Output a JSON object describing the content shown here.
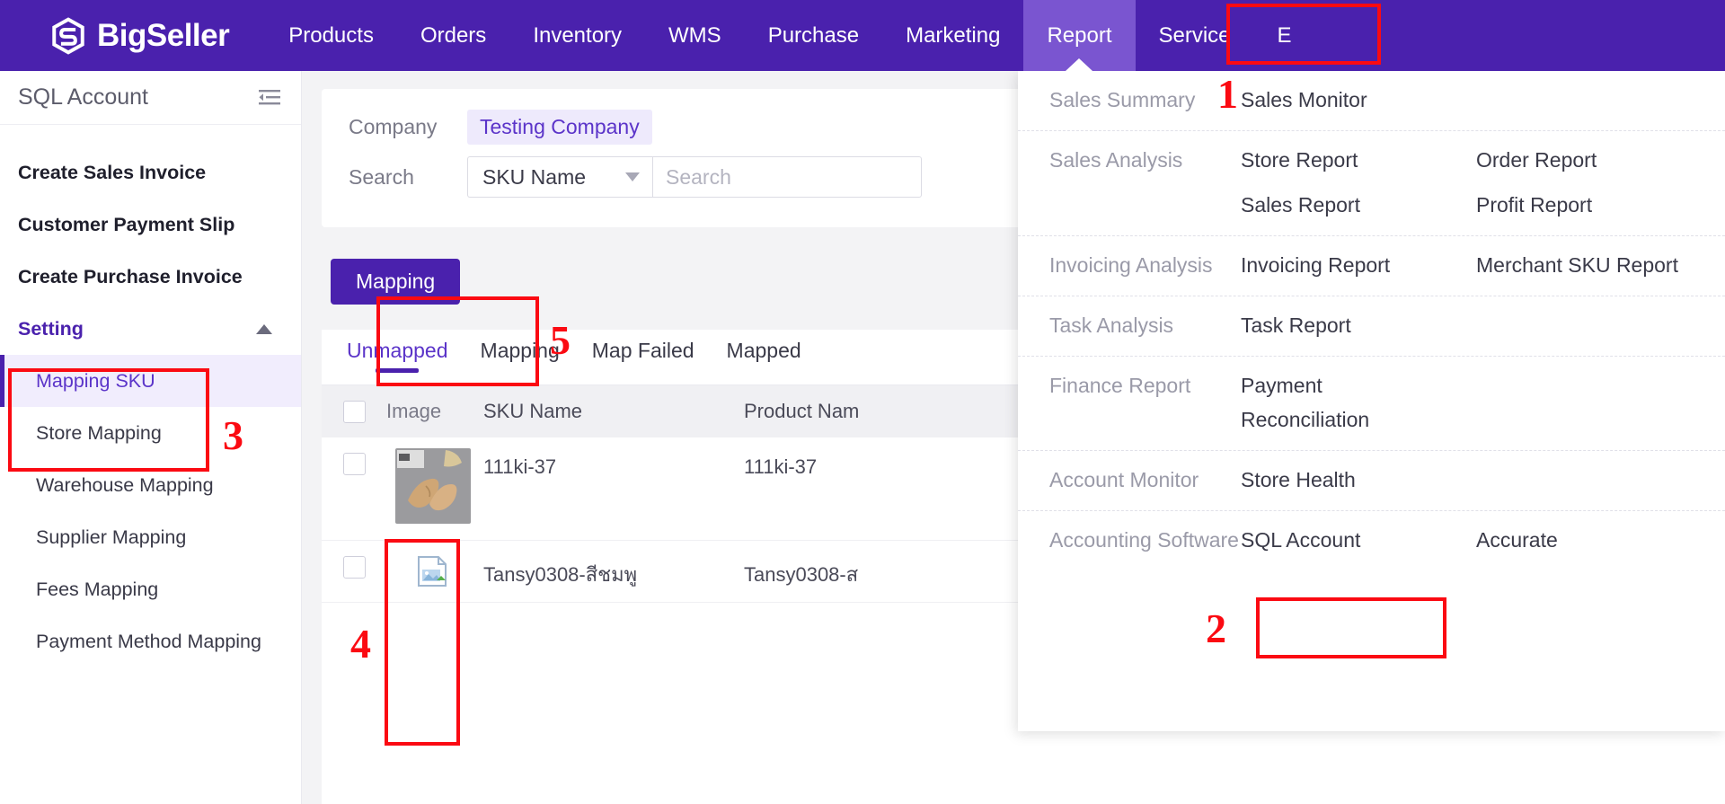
{
  "brand": {
    "name": "BigSeller",
    "logo_icon": "bigseller-logo-icon"
  },
  "topnav": {
    "items": [
      {
        "label": "Products",
        "active": false
      },
      {
        "label": "Orders",
        "active": false
      },
      {
        "label": "Inventory",
        "active": false
      },
      {
        "label": "WMS",
        "active": false
      },
      {
        "label": "Purchase",
        "active": false
      },
      {
        "label": "Marketing",
        "active": false
      },
      {
        "label": "Report",
        "active": true
      },
      {
        "label": "Service",
        "active": false
      },
      {
        "label": "E",
        "active": false
      }
    ]
  },
  "sidebar": {
    "title": "SQL Account",
    "collapse_icon": "collapse-panel-icon",
    "items": [
      {
        "label": "Create Sales Invoice",
        "type": "item"
      },
      {
        "label": "Customer Payment Slip",
        "type": "item"
      },
      {
        "label": "Create Purchase Invoice",
        "type": "item"
      },
      {
        "label": "Setting",
        "type": "group",
        "expanded": true,
        "chevron_icon": "chevron-up-icon"
      },
      {
        "label": "Mapping SKU",
        "type": "sub",
        "active": true
      },
      {
        "label": "Store Mapping",
        "type": "sub",
        "active": false
      },
      {
        "label": "Warehouse Mapping",
        "type": "sub",
        "active": false
      },
      {
        "label": "Supplier Mapping",
        "type": "sub",
        "active": false
      },
      {
        "label": "Fees Mapping",
        "type": "sub",
        "active": false
      },
      {
        "label": "Payment Method Mapping",
        "type": "sub",
        "active": false
      }
    ]
  },
  "filters": {
    "company_label": "Company",
    "company_value": "Testing Company",
    "search_label": "Search",
    "search_field_selected": "SKU Name",
    "search_placeholder": "Search",
    "dropdown_icon": "chevron-down-icon"
  },
  "toolbar": {
    "mapping_button": "Mapping"
  },
  "tabs": [
    {
      "label": "Unmapped",
      "active": true
    },
    {
      "label": "Mapping",
      "active": false
    },
    {
      "label": "Map Failed",
      "active": false
    },
    {
      "label": "Mapped",
      "active": false
    }
  ],
  "table": {
    "columns": [
      "Image",
      "SKU Name",
      "Product Nam"
    ],
    "rows": [
      {
        "sku_name": "111ki-37",
        "product_name": "111ki-37",
        "image_type": "photo"
      },
      {
        "sku_name": "Tansy0308-สีชมพู",
        "product_name": "Tansy0308-ส",
        "image_type": "broken"
      }
    ]
  },
  "mega_menu": {
    "sections": [
      {
        "category": "Sales Summary",
        "columns": [
          [
            "Sales Monitor"
          ],
          []
        ]
      },
      {
        "category": "Sales Analysis",
        "columns": [
          [
            "Store Report",
            "Sales Report"
          ],
          [
            "Order Report",
            "Profit Report"
          ]
        ]
      },
      {
        "category": "Invoicing Analysis",
        "columns": [
          [
            "Invoicing Report"
          ],
          [
            "Merchant SKU Report"
          ]
        ]
      },
      {
        "category": "Task Analysis",
        "columns": [
          [
            "Task Report"
          ],
          []
        ]
      },
      {
        "category": "Finance Report",
        "columns": [
          [
            "Payment Reconciliation"
          ],
          []
        ]
      },
      {
        "category": "Account Monitor",
        "columns": [
          [
            "Store Health"
          ],
          []
        ]
      },
      {
        "category": "Accounting Software",
        "columns": [
          [
            "SQL Account"
          ],
          [
            "Accurate"
          ]
        ]
      }
    ]
  },
  "annotations": [
    {
      "number": "1",
      "target": "report-nav-item"
    },
    {
      "number": "2",
      "target": "sql-account-menu-link"
    },
    {
      "number": "3",
      "target": "mapping-sku-sidebar-item"
    },
    {
      "number": "4",
      "target": "row-checkbox-column"
    },
    {
      "number": "5",
      "target": "mapping-button"
    }
  ],
  "colors": {
    "brand_purple": "#4a21ad",
    "nav_active": "#7a55d0",
    "accent_violet": "#5b34c9",
    "annotation_red": "#fb0a12"
  }
}
